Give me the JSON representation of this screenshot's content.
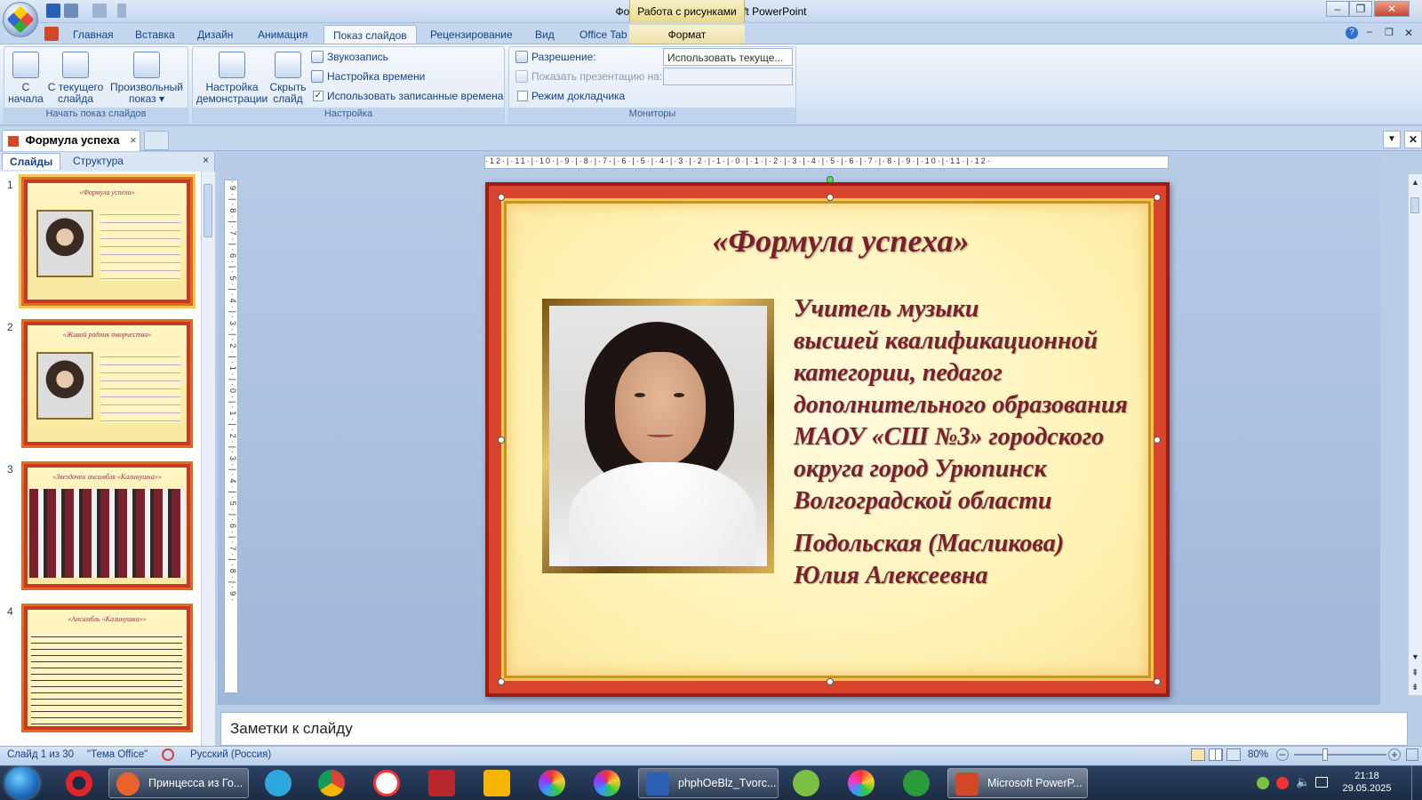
{
  "window": {
    "title": "Формула успеха - Microsoft PowerPoint",
    "context_tab_group": "Работа с рисунками"
  },
  "ribbon": {
    "tabs": [
      "Главная",
      "Вставка",
      "Дизайн",
      "Анимация",
      "Показ слайдов",
      "Рецензирование",
      "Вид",
      "Office Tab"
    ],
    "active_tab": "Показ слайдов",
    "context_tab": "Формат",
    "groups": {
      "start": {
        "label": "Начать показ слайдов",
        "from_start": "С начала",
        "from_current_1": "С текущего",
        "from_current_2": "слайда",
        "custom_1": "Произвольный",
        "custom_2": "показ ▾"
      },
      "setup": {
        "label": "Настройка",
        "setup_show_1": "Настройка",
        "setup_show_2": "демонстрации",
        "hide_1": "Скрыть",
        "hide_2": "слайд",
        "record": "Звукозапись",
        "rehearse": "Настройка времени",
        "use_timings": "Использовать записанные времена",
        "use_timings_checked": "✓"
      },
      "monitors": {
        "label": "Мониторы",
        "resolution_label": "Разрешение:",
        "resolution_value": "Использовать текуще...",
        "show_on_label": "Показать презентацию на:",
        "show_on_value": "",
        "presenter_view": "Режим докладчика"
      }
    }
  },
  "document_tab": {
    "name": "Формула успеха",
    "close": "×"
  },
  "left_pane": {
    "tabs": [
      "Слайды",
      "Структура"
    ],
    "close": "×",
    "thumbnails": [
      {
        "num": "1",
        "title": "«Формула успеха»"
      },
      {
        "num": "2",
        "title": "«Живой родник творчества»"
      },
      {
        "num": "3",
        "title": "«Звездочки ансамбля «Калинушка»»"
      },
      {
        "num": "4",
        "title": "«Ансамбль «Калинушка»»"
      }
    ]
  },
  "ruler": {
    "horizontal": "·12·|·11·|·10·|·9·|·8·|·7·|·6·|·5·|·4·|·3·|·2·|·1·|·0·|·1·|·2·|·3·|·4·|·5·|·6·|·7·|·8·|·9·|·10·|·11·|·12·",
    "vertical": "·9·|·8·|·7·|·6·|·5·|·4·|·3·|·2·|·1·|·0·|·1·|·2·|·3·|·4·|·5·|·6·|·7·|·8·|·9·"
  },
  "slide": {
    "title": "«Формула успеха»",
    "lines": [
      "Учитель музыки",
      "высшей квалификационной",
      "категории, педагог",
      "дополнительного образования",
      "МАОУ «СШ №3» городского",
      "округа город Урюпинск",
      "Волгоградской области"
    ],
    "name_lines": [
      "Подольская (Масликова)",
      "Юлия Алексеевна"
    ]
  },
  "notes": {
    "placeholder": "Заметки к слайду"
  },
  "status": {
    "slide": "Слайд 1 из 30",
    "theme": "\"Тема Office\"",
    "language": "Русский (Россия)",
    "zoom": "80%"
  },
  "taskbar": {
    "apps": [
      {
        "label": "Принцесса из Го...",
        "color": "#e8632b"
      },
      {
        "label": "phphOeBlz_Tvorc...",
        "color": "#2b5fb4"
      },
      {
        "label": "Microsoft PowerP...",
        "color": "#d24726"
      }
    ],
    "time": "21:18",
    "date": "29.05.2025"
  },
  "colors": {
    "accent": "#15428b",
    "slide_text": "#7a1f2b",
    "frame_red": "#d8452c"
  }
}
